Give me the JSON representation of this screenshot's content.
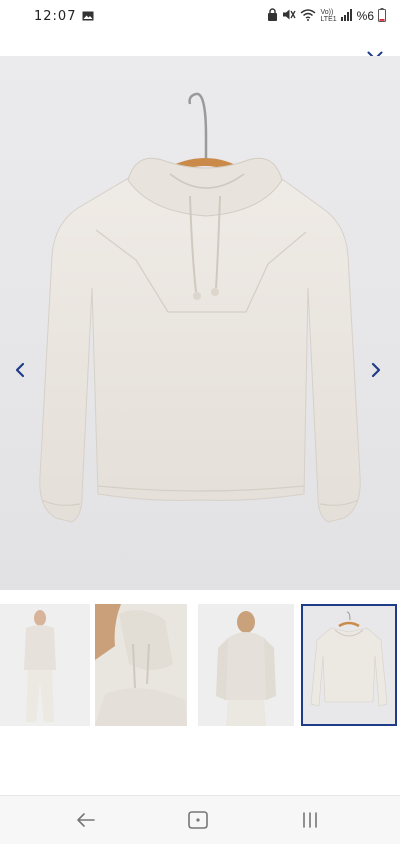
{
  "status_bar": {
    "time": "12:07",
    "battery": "%6",
    "network_label_top": "Vo))",
    "network_label_bottom": "LTE1",
    "icons": [
      "image-icon",
      "lock-icon",
      "mute-icon",
      "wifi-icon",
      "signal-icon",
      "battery-icon"
    ]
  },
  "viewer": {
    "close_icon": "close-icon",
    "prev_icon": "chevron-left-icon",
    "next_icon": "chevron-right-icon",
    "accent_color": "#1f3c8a"
  },
  "main_image": {
    "subject": "hooded sweatshirt on hanger",
    "color": "#e9e4de"
  },
  "thumbnails": [
    {
      "subject": "model front full body",
      "selected": false
    },
    {
      "subject": "hood close-up",
      "selected": false
    },
    {
      "subject": "model back view",
      "selected": false
    },
    {
      "subject": "product on hanger",
      "selected": true
    }
  ],
  "nav_bar": {
    "back_icon": "back-arrow-icon",
    "home_icon": "home-icon",
    "recents_icon": "recents-icon"
  }
}
